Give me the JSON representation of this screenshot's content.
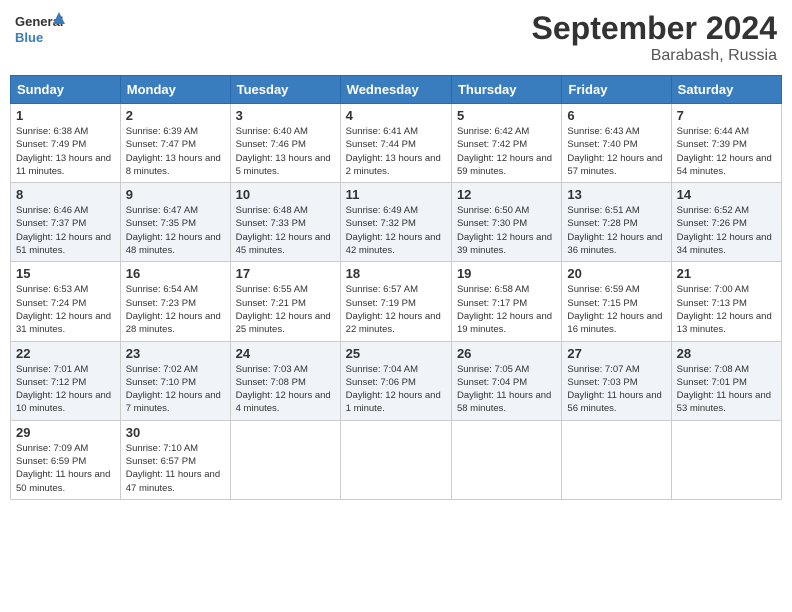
{
  "header": {
    "logo_line1": "General",
    "logo_line2": "Blue",
    "month_title": "September 2024",
    "location": "Barabash, Russia"
  },
  "days_of_week": [
    "Sunday",
    "Monday",
    "Tuesday",
    "Wednesday",
    "Thursday",
    "Friday",
    "Saturday"
  ],
  "weeks": [
    [
      {
        "day": "1",
        "sunrise": "6:38 AM",
        "sunset": "7:49 PM",
        "daylight": "13 hours and 11 minutes."
      },
      {
        "day": "2",
        "sunrise": "6:39 AM",
        "sunset": "7:47 PM",
        "daylight": "13 hours and 8 minutes."
      },
      {
        "day": "3",
        "sunrise": "6:40 AM",
        "sunset": "7:46 PM",
        "daylight": "13 hours and 5 minutes."
      },
      {
        "day": "4",
        "sunrise": "6:41 AM",
        "sunset": "7:44 PM",
        "daylight": "13 hours and 2 minutes."
      },
      {
        "day": "5",
        "sunrise": "6:42 AM",
        "sunset": "7:42 PM",
        "daylight": "12 hours and 59 minutes."
      },
      {
        "day": "6",
        "sunrise": "6:43 AM",
        "sunset": "7:40 PM",
        "daylight": "12 hours and 57 minutes."
      },
      {
        "day": "7",
        "sunrise": "6:44 AM",
        "sunset": "7:39 PM",
        "daylight": "12 hours and 54 minutes."
      }
    ],
    [
      {
        "day": "8",
        "sunrise": "6:46 AM",
        "sunset": "7:37 PM",
        "daylight": "12 hours and 51 minutes."
      },
      {
        "day": "9",
        "sunrise": "6:47 AM",
        "sunset": "7:35 PM",
        "daylight": "12 hours and 48 minutes."
      },
      {
        "day": "10",
        "sunrise": "6:48 AM",
        "sunset": "7:33 PM",
        "daylight": "12 hours and 45 minutes."
      },
      {
        "day": "11",
        "sunrise": "6:49 AM",
        "sunset": "7:32 PM",
        "daylight": "12 hours and 42 minutes."
      },
      {
        "day": "12",
        "sunrise": "6:50 AM",
        "sunset": "7:30 PM",
        "daylight": "12 hours and 39 minutes."
      },
      {
        "day": "13",
        "sunrise": "6:51 AM",
        "sunset": "7:28 PM",
        "daylight": "12 hours and 36 minutes."
      },
      {
        "day": "14",
        "sunrise": "6:52 AM",
        "sunset": "7:26 PM",
        "daylight": "12 hours and 34 minutes."
      }
    ],
    [
      {
        "day": "15",
        "sunrise": "6:53 AM",
        "sunset": "7:24 PM",
        "daylight": "12 hours and 31 minutes."
      },
      {
        "day": "16",
        "sunrise": "6:54 AM",
        "sunset": "7:23 PM",
        "daylight": "12 hours and 28 minutes."
      },
      {
        "day": "17",
        "sunrise": "6:55 AM",
        "sunset": "7:21 PM",
        "daylight": "12 hours and 25 minutes."
      },
      {
        "day": "18",
        "sunrise": "6:57 AM",
        "sunset": "7:19 PM",
        "daylight": "12 hours and 22 minutes."
      },
      {
        "day": "19",
        "sunrise": "6:58 AM",
        "sunset": "7:17 PM",
        "daylight": "12 hours and 19 minutes."
      },
      {
        "day": "20",
        "sunrise": "6:59 AM",
        "sunset": "7:15 PM",
        "daylight": "12 hours and 16 minutes."
      },
      {
        "day": "21",
        "sunrise": "7:00 AM",
        "sunset": "7:13 PM",
        "daylight": "12 hours and 13 minutes."
      }
    ],
    [
      {
        "day": "22",
        "sunrise": "7:01 AM",
        "sunset": "7:12 PM",
        "daylight": "12 hours and 10 minutes."
      },
      {
        "day": "23",
        "sunrise": "7:02 AM",
        "sunset": "7:10 PM",
        "daylight": "12 hours and 7 minutes."
      },
      {
        "day": "24",
        "sunrise": "7:03 AM",
        "sunset": "7:08 PM",
        "daylight": "12 hours and 4 minutes."
      },
      {
        "day": "25",
        "sunrise": "7:04 AM",
        "sunset": "7:06 PM",
        "daylight": "12 hours and 1 minute."
      },
      {
        "day": "26",
        "sunrise": "7:05 AM",
        "sunset": "7:04 PM",
        "daylight": "11 hours and 58 minutes."
      },
      {
        "day": "27",
        "sunrise": "7:07 AM",
        "sunset": "7:03 PM",
        "daylight": "11 hours and 56 minutes."
      },
      {
        "day": "28",
        "sunrise": "7:08 AM",
        "sunset": "7:01 PM",
        "daylight": "11 hours and 53 minutes."
      }
    ],
    [
      {
        "day": "29",
        "sunrise": "7:09 AM",
        "sunset": "6:59 PM",
        "daylight": "11 hours and 50 minutes."
      },
      {
        "day": "30",
        "sunrise": "7:10 AM",
        "sunset": "6:57 PM",
        "daylight": "11 hours and 47 minutes."
      },
      null,
      null,
      null,
      null,
      null
    ]
  ]
}
